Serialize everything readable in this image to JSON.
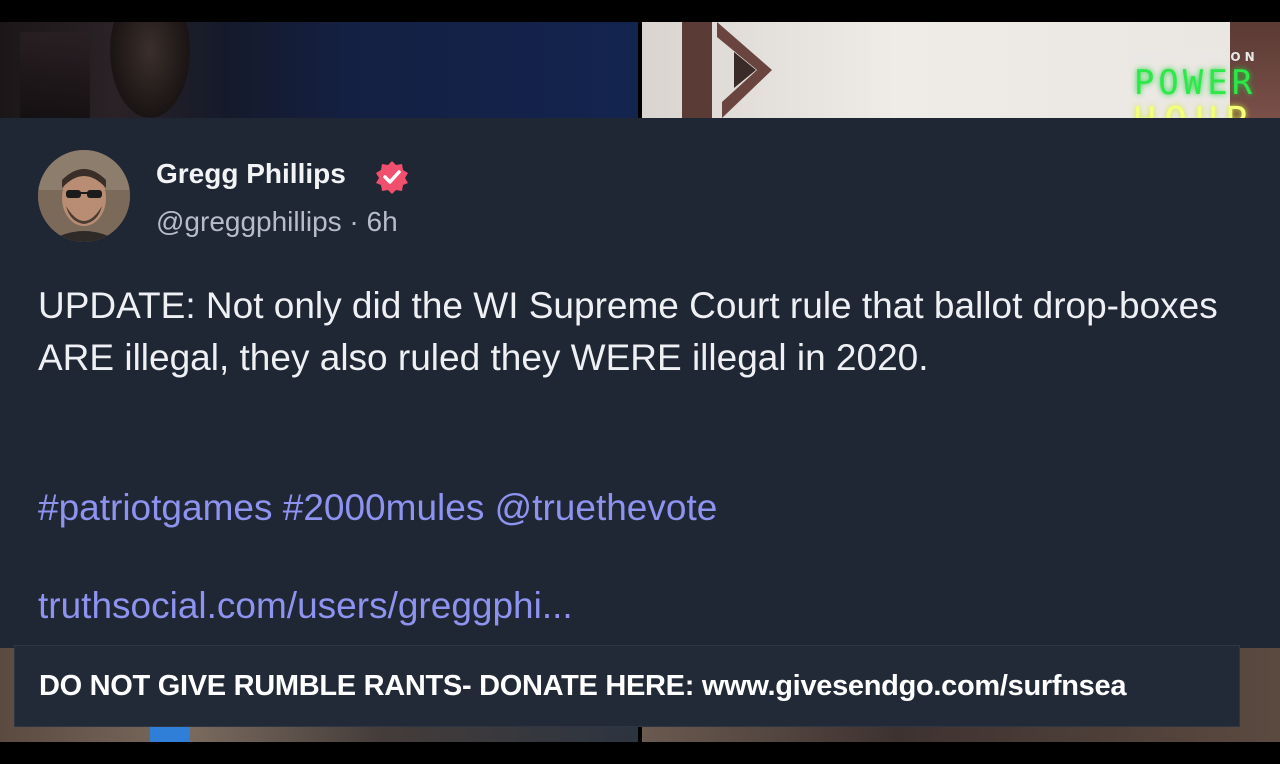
{
  "watermark": {
    "brand_top": "DEVOLUTION",
    "brand_line1": "POWER",
    "brand_line2": "HOUR"
  },
  "post": {
    "author_name": "Gregg Phillips",
    "handle": "@greggphillips",
    "separator": "·",
    "time": "6h",
    "body": "UPDATE: Not only did the WI Supreme Court rule that ballot drop-boxes ARE illegal, they also ruled they WERE illegal in 2020.",
    "hashtags": [
      "#patriotgames",
      "#2000mules",
      "@truethevote"
    ],
    "link": "truthsocial.com/users/greggphi..."
  },
  "banner": {
    "text": "DO NOT GIVE RUMBLE RANTS- DONATE HERE: www.givesendgo.com/surfnsea"
  },
  "colors": {
    "card_bg": "#1f2634",
    "link_color": "#8d93ef",
    "verified_badge": "#f0506e",
    "power_green": "#2ee84a",
    "hour_yellow": "#f3ff7a"
  },
  "icons": {
    "verified": "verified-badge-icon",
    "avatar": "profile-avatar"
  }
}
